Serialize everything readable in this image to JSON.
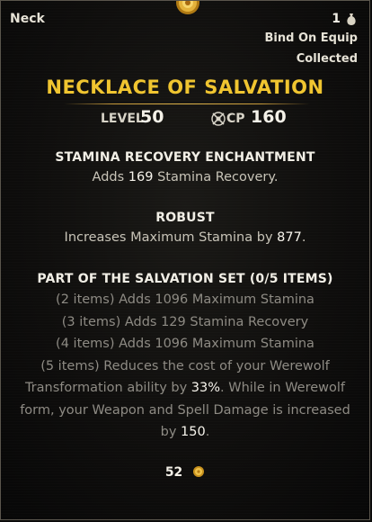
{
  "header": {
    "slot": "Neck",
    "count": "1",
    "bind": "Bind On Equip",
    "status": "Collected"
  },
  "item": {
    "name": "NECKLACE OF SALVATION",
    "level_label": "LEVEL",
    "level_value": "50",
    "cp_label": "CP",
    "cp_value": "160"
  },
  "enchantment": {
    "heading": "STAMINA RECOVERY ENCHANTMENT",
    "pre": "Adds ",
    "value": "169",
    "post": " Stamina Recovery."
  },
  "trait": {
    "heading": "ROBUST",
    "pre": "Increases Maximum Stamina by ",
    "value": "877",
    "post": "."
  },
  "set": {
    "heading": "PART OF THE SALVATION SET (0/5 ITEMS)",
    "bonus2": "(2 items) Adds 1096 Maximum Stamina",
    "bonus3": "(3 items) Adds 129 Stamina Recovery",
    "bonus4": "(4 items) Adds 1096 Maximum Stamina",
    "bonus5_line1": "(5 items) Reduces the cost of your Werewolf",
    "bonus5_line2_pre": "Transformation ability by ",
    "bonus5_line2_value": "33%",
    "bonus5_line2_post": ". While in Werewolf",
    "bonus5_line3": "form, your Weapon and Spell Damage is increased",
    "bonus5_line4_pre": "by ",
    "bonus5_line4_value": "150",
    "bonus5_line4_post": "."
  },
  "price": {
    "value": "52"
  },
  "icons": {
    "item": "necklace-icon",
    "bag": "bag-icon",
    "cp": "champion-point-icon",
    "coin": "gold-coin-icon"
  },
  "colors": {
    "title": "#f0c530",
    "divider": "#c79a3a",
    "text": "#c8c4b8",
    "inactive": "#8e8b84"
  }
}
